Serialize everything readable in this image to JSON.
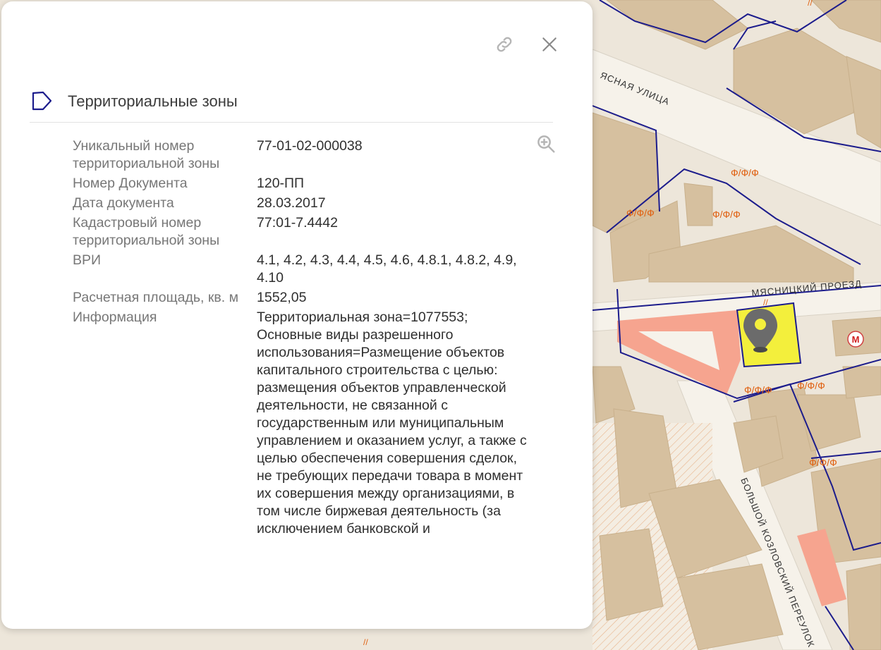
{
  "map": {
    "streets": [
      "ЯСНАЯ УЛИЦА",
      "МЯСНИЦКИЙ ПРОЕЗД",
      "БОЛЬШОЙ КОЗЛОВСКИЙ ПЕРЕУЛОК"
    ],
    "zone_labels": [
      "Ф/Ф/Ф",
      "Ф/Ф/Ф",
      "Ф/Ф/Ф",
      "Ф/Ф/Ф",
      "Ф/Ф/Ф",
      "Ф/Ф/Ф"
    ],
    "slash_marks": [
      "//",
      "//",
      "//"
    ],
    "metro_letter": "М",
    "colors": {
      "building": "#d6c09f",
      "boundary": "#1c1c8c",
      "highlight": "#f3ef3c",
      "salmon": "#f6a48f",
      "road": "#f4efe6",
      "marker": "#6b6b6b",
      "accent_label": "#e06010"
    }
  },
  "panel": {
    "icons": {
      "link": "link-icon",
      "close": "close-icon",
      "section": "polygon-zone-icon",
      "zoom": "zoom-in-icon"
    },
    "section_title": "Территориальные зоны",
    "properties": [
      {
        "label": "Уникальный номер территориальной зоны",
        "value": "77-01-02-000038"
      },
      {
        "label": "Номер Документа",
        "value": "120-ПП"
      },
      {
        "label": "Дата документа",
        "value": "28.03.2017"
      },
      {
        "label": "Кадастровый номер территориальной зоны",
        "value": "77:01-7.4442"
      },
      {
        "label": "ВРИ",
        "value": "4.1, 4.2, 4.3, 4.4, 4.5, 4.6, 4.8.1, 4.8.2, 4.9, 4.10"
      },
      {
        "label": "Расчетная площадь, кв. м",
        "value": "1552,05"
      },
      {
        "label": "Информация",
        "value": "Территориальная зона=1077553; Основные виды разрешенного использования=Размещение объектов капитального строительства с целью: размещения объектов управленческой деятельности, не связанной с государственным или муниципальным управлением и оказанием услуг, а также с целью обеспечения совершения сделок, не требующих передачи товара в момент их совершения между организациями, в том числе биржевая деятельность (за исключением банковской и"
      }
    ]
  }
}
